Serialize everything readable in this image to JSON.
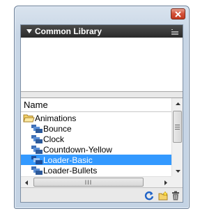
{
  "window": {
    "close_icon": "close-x-icon"
  },
  "panel": {
    "title": "Common Library",
    "collapse_icon": "triangle-down-icon",
    "menu_icon": "panel-menu-icon"
  },
  "list": {
    "header": "Name",
    "items": [
      {
        "label": "Animations",
        "type": "folder",
        "icon": "folder-open-icon",
        "selected": false
      },
      {
        "label": "Bounce",
        "type": "symbol",
        "icon": "movieclip-icon",
        "selected": false
      },
      {
        "label": "Clock",
        "type": "symbol",
        "icon": "movieclip-icon",
        "selected": false
      },
      {
        "label": "Countdown-Yellow",
        "type": "symbol",
        "icon": "movieclip-icon",
        "selected": false
      },
      {
        "label": "Loader-Basic",
        "type": "symbol",
        "icon": "movieclip-icon",
        "selected": true
      },
      {
        "label": "Loader-Bullets",
        "type": "symbol",
        "icon": "movieclip-icon",
        "selected": false
      }
    ],
    "hscroll_grip": "III"
  },
  "toolbar": {
    "buttons": [
      "refresh-icon",
      "new-folder-icon",
      "delete-icon"
    ]
  },
  "colors": {
    "selection": "#3399ff",
    "titlebar": "#2a2a2a",
    "close": "#c2381e"
  }
}
